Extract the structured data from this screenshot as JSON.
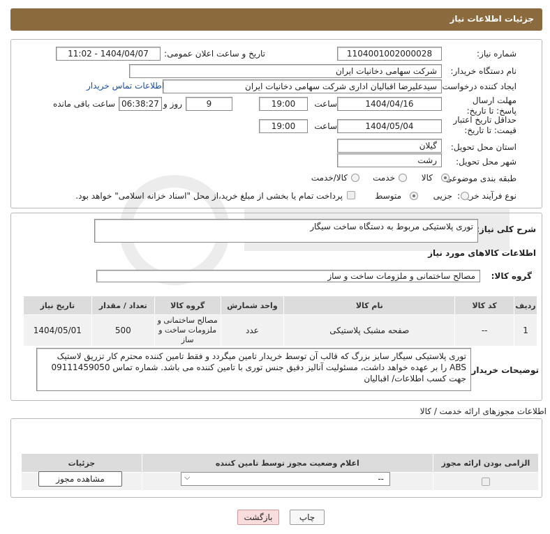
{
  "header": {
    "title": "جزئیات اطلاعات نیاز"
  },
  "form": {
    "need_number_label": "شماره نیاز:",
    "need_number": "1104001002000028",
    "announce_label": "تاریخ و ساعت اعلان عمومی:",
    "announce_value": "1404/04/07 - 11:02",
    "buyer_org_label": "نام دستگاه خریدار:",
    "buyer_org": "شرکت سهامی دخانیات ایران",
    "creator_label": "ایجاد کننده درخواست:",
    "creator": "سیدعلیرضا اقبالیان اداری شرکت سهامی دخانیات ایران",
    "contact_link": "اطلاعات تماس خریدار",
    "deadline_label": "مهلت ارسال پاسخ: تا تاریخ:",
    "deadline_date": "1404/04/16",
    "hour_label": "ساعت",
    "deadline_time": "19:00",
    "days_value": "9",
    "days_label": "روز و",
    "remaining_time": "06:38:27",
    "remaining_label": "ساعت باقی مانده",
    "min_price_label": "حداقل تاریخ اعتبار قیمت: تا تاریخ:",
    "min_price_date": "1404/05/04",
    "min_price_time": "19:00",
    "province_label": "استان محل تحویل:",
    "province": "گیلان",
    "city_label": "شهر محل تحویل:",
    "city": "رشت",
    "category_label": "طبقه بندی موضوعی:",
    "category_options": [
      "کالا",
      "خدمت",
      "کالا/خدمت"
    ],
    "process_label": "نوع فرآیند خرید :",
    "process_options": [
      "جزیی",
      "متوسط"
    ],
    "payment_note": "پرداخت تمام یا بخشی از مبلغ خرید،از محل \"اسناد خزانه اسلامی\" خواهد بود."
  },
  "description": {
    "label": "شرح کلی نیاز:",
    "text": "توری پلاستیکی مربوط به دستگاه ساخت سیگار"
  },
  "goods": {
    "section_title": "اطلاعات کالاهای مورد نیاز",
    "group_label": "گروه کالا:",
    "group_value": "مصالح ساختمانی و ملزومات ساخت و ساز",
    "columns": [
      "ردیف",
      "کد کالا",
      "نام کالا",
      "واحد شمارش",
      "گروه کالا",
      "تعداد / مقدار",
      "تاریخ نیاز"
    ],
    "rows": [
      {
        "row": "1",
        "code": "--",
        "name": "صفحه مشبک پلاستیکی",
        "unit": "عدد",
        "group": "مصالح ساختمانی و ملزومات ساخت و ساز",
        "qty": "500",
        "date": "1404/05/01"
      }
    ]
  },
  "buyer_notes": {
    "label": "توضیحات خریدار:",
    "text": "توری پلاستیکی سیگار سایز بزرگ که قالب آن توسط خریدار  تامین میگردد و فقط تامین کننده محترم کار تزریق لاستیک ABS را بر عهده خواهد داشت، مسئولیت آنالیز دقیق جنس توری با تامین کننده می باشد. شماره تماس 09111459050 جهت کسب اطلاعات/ اقبالیان"
  },
  "permits": {
    "title": "اطلاعات مجوزهای ارائه خدمت / کالا",
    "columns": [
      "الزامی بودن ارائه مجوز",
      "اعلام وضعیت مجوز توسط تامین کننده",
      "جزئیات"
    ],
    "select_value": "--",
    "view_button": "مشاهده مجوز"
  },
  "footer": {
    "print_button": "چاپ",
    "back_button": "بازگشت"
  },
  "colors": {
    "header": "#8b6a3d",
    "accent_link": "#1a4fa0"
  }
}
